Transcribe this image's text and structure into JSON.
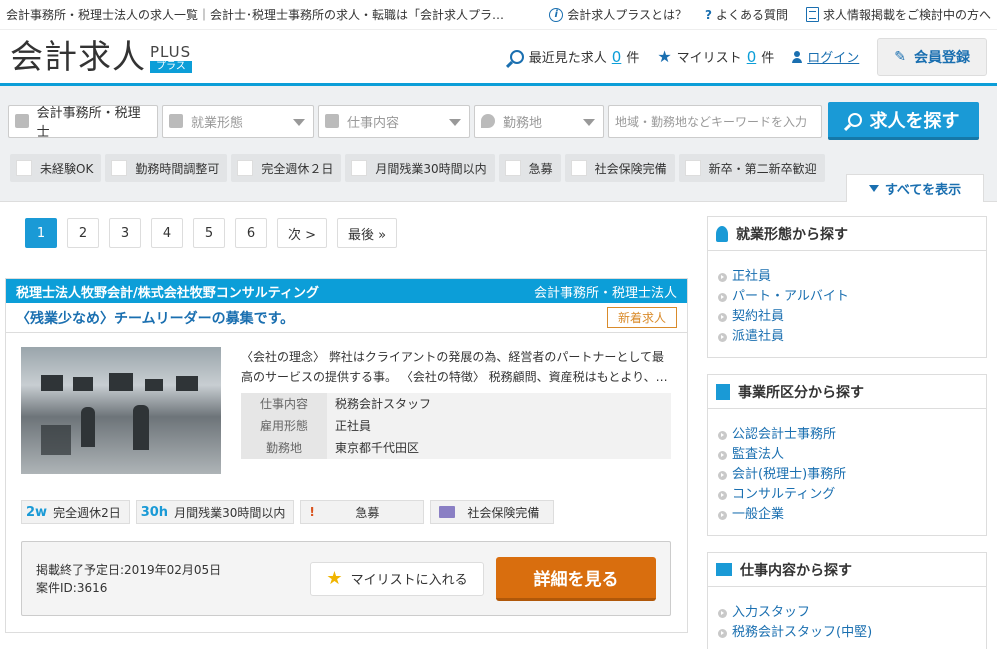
{
  "topbar": {
    "crumb": "会計事務所・税理士法人の求人一覧｜会計士･税理士事務所の求人・転職は「会計求人プラ…",
    "about": "会計求人プラスとは？",
    "faq": "よくある質問",
    "posting": "求人情報掲載をご検討中の方へ"
  },
  "header": {
    "logo": "会計求人",
    "logo_plus": "PLUS",
    "logo_kana": "プラス",
    "recent_label": "最近見た求人",
    "recent_count": "0",
    "recent_unit": "件",
    "mylist_label": "マイリスト",
    "mylist_count": "0",
    "mylist_unit": "件",
    "login": "ログイン",
    "register": "会員登録"
  },
  "search": {
    "category": "会計事務所・税理士",
    "employment": "就業形態",
    "job": "仕事内容",
    "location": "勤務地",
    "keyword_placeholder": "地域・勤務地などキーワードを入力",
    "button": "求人を探す",
    "chips": [
      "未経験OK",
      "勤務時間調整可",
      "完全週休２日",
      "月間残業30時間以内",
      "急募",
      "社会保険完備",
      "新卒・第二新卒歓迎"
    ],
    "show_all": "すべてを表示"
  },
  "pager": {
    "pages": [
      "1",
      "2",
      "3",
      "4",
      "5",
      "6"
    ],
    "next": "次 >",
    "last": "最後 »"
  },
  "job": {
    "company": "税理士法人牧野会計/株式会社牧野コンサルティング",
    "type": "会計事務所・税理士法人",
    "title": "〈残業少なめ〉チームリーダーの募集です。",
    "badge": "新着求人",
    "description": "〈会社の理念〉 弊社はクライアントの発展の為、経営者のパートナーとして最高のサービスの提供する事。 〈会社の特徴〉 税務顧問、資産税はもとより、…",
    "details": [
      {
        "k": "仕事内容",
        "v": "税務会計スタッフ"
      },
      {
        "k": "雇用形態",
        "v": "正社員"
      },
      {
        "k": "勤務地",
        "v": "東京都千代田区"
      }
    ],
    "tags": [
      {
        "icon": "2w",
        "label": "完全週休2日"
      },
      {
        "icon": "30h",
        "label": "月間残業30時間以内"
      },
      {
        "icon": "!",
        "label": "急募"
      },
      {
        "icon": "",
        "label": "社会保険完備"
      }
    ],
    "end_date": "掲載終了予定日:2019年02月05日",
    "case_id": "案件ID:3616",
    "add_mylist": "マイリストに入れる",
    "detail_button": "詳細を見る"
  },
  "sidebar": [
    {
      "title": "就業形態から探す",
      "items": [
        "正社員",
        "パート・アルバイト",
        "契約社員",
        "派遣社員"
      ]
    },
    {
      "title": "事業所区分から探す",
      "items": [
        "公認会計士事務所",
        "監査法人",
        "会計(税理士)事務所",
        "コンサルティング",
        "一般企業"
      ]
    },
    {
      "title": "仕事内容から探す",
      "items": [
        "入力スタッフ",
        "税務会計スタッフ(中堅)"
      ]
    }
  ],
  "colors": {
    "accent": "#0c9ed8",
    "link": "#1a6fb0",
    "cta": "#d96e0e"
  }
}
